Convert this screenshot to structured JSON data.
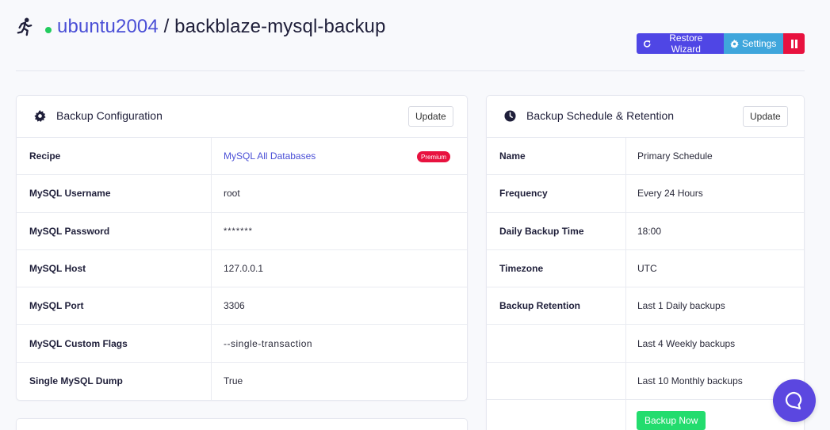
{
  "header": {
    "server": "ubuntu2004",
    "separator": "/",
    "app": "backblaze-mysql-backup"
  },
  "actions": {
    "restore_label": "Restore Wizard",
    "settings_label": "Settings"
  },
  "config": {
    "title": "Backup Configuration",
    "update_label": "Update",
    "rows": [
      {
        "label": "Recipe",
        "value": "MySQL All Databases",
        "badge": "Premium"
      },
      {
        "label": "MySQL Username",
        "value": "root"
      },
      {
        "label": "MySQL Password",
        "value": "*******"
      },
      {
        "label": "MySQL Host",
        "value": "127.0.0.1"
      },
      {
        "label": "MySQL Port",
        "value": "3306"
      },
      {
        "label": "MySQL Custom Flags",
        "value": "--single-transaction"
      },
      {
        "label": "Single MySQL Dump",
        "value": "True"
      }
    ]
  },
  "schedule": {
    "title": "Backup Schedule & Retention",
    "update_label": "Update",
    "rows": [
      {
        "label": "Name",
        "value": "Primary Schedule"
      },
      {
        "label": "Frequency",
        "value": "Every 24 Hours"
      },
      {
        "label": "Daily Backup Time",
        "value": "18:00"
      },
      {
        "label": "Timezone",
        "value": "UTC"
      },
      {
        "label": "Backup Retention",
        "value": "Last 1 Daily backups"
      },
      {
        "label": "",
        "value": "Last 4 Weekly backups"
      },
      {
        "label": "",
        "value": "Last 10 Monthly backups"
      }
    ],
    "backup_now_label": "Backup Now"
  },
  "colors": {
    "accent": "#4f46e5",
    "info": "#3fa6dc",
    "danger": "#e8123f",
    "success": "#23dc6e",
    "status_online": "#22cc5e"
  }
}
